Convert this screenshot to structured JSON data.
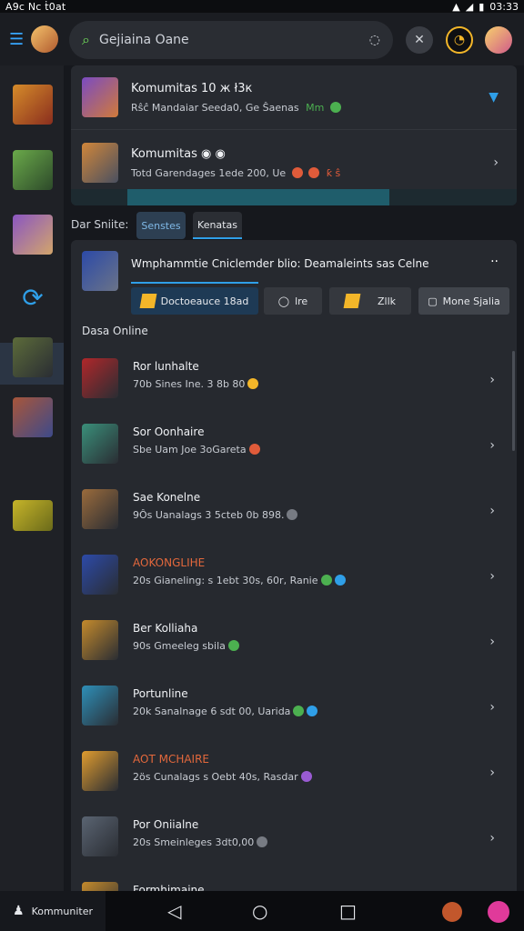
{
  "status_bar": {
    "left_text": "A9c  Nc  ṫ0at",
    "time": "03:33",
    "icons": [
      "wifi-icon",
      "signal-icon",
      "battery-icon"
    ]
  },
  "top_bar": {
    "menu_icon": "menu-icon",
    "search_placeholder": "Gejiaina Oane",
    "search_icon": "search-icon",
    "mic_icon": "mic-icon",
    "buttons": [
      "close-icon",
      "profile-icon"
    ]
  },
  "sidebar": {
    "items": [
      {
        "icon": "game-icon-1",
        "color": "#d58b2a"
      },
      {
        "icon": "game-icon-2",
        "color": "#6aa94a"
      },
      {
        "icon": "game-icon-3",
        "color": "#8a56c2"
      },
      {
        "icon": "sync-icon",
        "color": "#2f9fe8"
      },
      {
        "icon": "game-icon-4",
        "color": "#5c6b3a"
      },
      {
        "icon": "game-icon-5",
        "color": "#a8563a"
      },
      {
        "icon": "game-icon-6",
        "color": "#c6b429"
      }
    ]
  },
  "communities": [
    {
      "title": "Komumitas  10  ж  ł3к",
      "subtitle": "Rŝĉ  Mandaiar  Seeda0,  Ge  Ŝaenas",
      "tag": "Mm",
      "accent": "#2f9fe8"
    },
    {
      "title": "Komumitas  ◉ ◉",
      "subtitle": "Totd  Garendages  1ede  200,  Ue",
      "tag": "ƙ  ŝ",
      "accent": "#e05b3a"
    }
  ],
  "filter": {
    "label": "Dar Sniite:",
    "tabs": [
      {
        "label": "Senstes",
        "active": true
      },
      {
        "label": "Kenatas",
        "active": false
      }
    ]
  },
  "game_header": {
    "title": "Wmphammtie  Cniclemder  blio:  Deamaleints  sas  Celne",
    "more": "··",
    "chips": [
      "Doctoeauce 18ad",
      "lre",
      "Zllk",
      "Mone Sjalia"
    ],
    "section_label": "Dasa Online"
  },
  "players": [
    {
      "name": "Ror lunhalte",
      "status": "70b Sines Ine. 3 8b 80",
      "color": "#b0272a",
      "name_color": "#f0f2f5",
      "dots": [
        "#f3b629"
      ]
    },
    {
      "name": "Sor Oonhaire",
      "status": "Sbe Uam Joe 3oGareta",
      "color": "#3a8f7a",
      "name_color": "#f0f2f5",
      "dots": [
        "#e05b3a"
      ]
    },
    {
      "name": "Sae Konelne",
      "status": "9Ôs Uanalags 3 5cteb 0b 898.",
      "color": "#9a6b3c",
      "name_color": "#f0f2f5",
      "dots": [
        "#777b83"
      ]
    },
    {
      "name": "AOKONGLIHE",
      "status": "20s Gianeling: s 1ebt 30s, 60r, Ranie",
      "color": "#2c4aa8",
      "name_color": "#e3683c",
      "dots": [
        "#4cb050",
        "#2f9fe8"
      ]
    },
    {
      "name": "Ber Kolliaha",
      "status": "90s Gmeeleg sbila",
      "color": "#c48a2c",
      "name_color": "#f0f2f5",
      "dots": [
        "#4cb050"
      ]
    },
    {
      "name": "Portunline",
      "status": "20k Sanalnage 6 sdt 00, Uarida",
      "color": "#2e8fb8",
      "name_color": "#f0f2f5",
      "dots": [
        "#4cb050",
        "#2f9fe8"
      ]
    },
    {
      "name": "AOT MCHAIRE",
      "status": "2ös Cunalags s Oebt 40s, Rasdar",
      "color": "#e09c2f",
      "name_color": "#e3683c",
      "dots": [
        "#9a5bd3"
      ]
    },
    {
      "name": "Por Oniialne",
      "status": "20s Smeinleges 3dt0,00",
      "color": "#5a6472",
      "name_color": "#f0f2f5",
      "dots": [
        "#777b83"
      ]
    },
    {
      "name": "Formhimaine",
      "status": "",
      "color": "#c48a2c",
      "name_color": "#f0f2f5",
      "dots": []
    }
  ],
  "bottom_nav": {
    "label": "Kommuniter",
    "back_icon": "back-icon",
    "home_icon": "home-icon",
    "recents_icon": "recents-icon"
  }
}
